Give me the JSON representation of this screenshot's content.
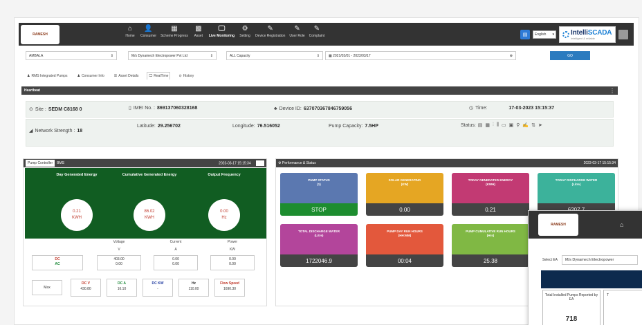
{
  "logo": {
    "text": "RAMESH"
  },
  "nav": [
    {
      "label": "Home",
      "icon": "home-icon",
      "glyph": "⌂"
    },
    {
      "label": "Consumer",
      "icon": "user-icon",
      "glyph": "👤"
    },
    {
      "label": "Scheme Progress",
      "icon": "table-icon",
      "glyph": "▦"
    },
    {
      "label": "Asset",
      "icon": "grid-icon",
      "glyph": "▩"
    },
    {
      "label": "Live Monitoring",
      "icon": "monitor-icon",
      "glyph": "🖵"
    },
    {
      "label": "Setting",
      "icon": "gear-icon",
      "glyph": "⚙"
    },
    {
      "label": "Device Registration",
      "icon": "edit-icon",
      "glyph": "✎"
    },
    {
      "label": "User Role",
      "icon": "edit-icon",
      "glyph": "✎"
    },
    {
      "label": "Complaint",
      "icon": "edit-icon",
      "glyph": "✎"
    }
  ],
  "language": "English",
  "brand": {
    "name_a": "Intelli",
    "name_b": "SCADA",
    "tagline": "Intelligent & reliable"
  },
  "filters": {
    "district": "AMBALA",
    "company": "M/s Dynamech Electropower Pvt Ltd",
    "capacity": "ALL Capacity",
    "daterange": "2021/03/01 - 2023/03/17",
    "go": "GO"
  },
  "subtabs": [
    {
      "label": "RMS Integrated Pumps",
      "glyph": "♟"
    },
    {
      "label": "Consumer Info",
      "glyph": "♟"
    },
    {
      "label": "Asset Details",
      "glyph": "☰"
    },
    {
      "label": "RealTime",
      "glyph": "🖵"
    },
    {
      "label": "History",
      "glyph": "⊙"
    }
  ],
  "heartbeat": {
    "title": "Heartbeat",
    "site_label": "Site :",
    "site": "SEDM C8168 0",
    "imei_label": "IMEI No. :",
    "imei": "869137060328168",
    "device_label": "Device ID:",
    "device": "637070367846759056",
    "time_label": "Time:",
    "time": "17-03-2023 15:15:37",
    "network_label": "Network Strength :",
    "network": "18",
    "lat_label": "Latitude:",
    "lat": "29.256702",
    "lon_label": "Longitude:",
    "lon": "76.516052",
    "cap_label": "Pump Capacity:",
    "cap": "7.5HP",
    "status_label": "Status:",
    "status_icons": [
      "▤",
      "▦",
      "⫶",
      "⫼",
      "▭",
      "▣",
      "⚲",
      "✍",
      "⇅",
      "➤"
    ]
  },
  "pump_controller": {
    "tab1": "Pump Controller",
    "tab2": "BMS",
    "timestamp": "2023-03-17 15:15:34",
    "cols": [
      {
        "label": "Day Generated Energy",
        "value": "0.21",
        "unit": "KWH"
      },
      {
        "label": "Cumulative Generated Energy",
        "value": "86.02",
        "unit": "KWH"
      },
      {
        "label": "Output Frequency",
        "value": "0.00",
        "unit": "Hz"
      }
    ],
    "voltage": "Voltage",
    "voltage_unit": "V",
    "current": "Current",
    "current_unit": "A",
    "power": "Power",
    "power_unit": "KW",
    "dc": "DC",
    "ac": "AC",
    "dc_vals": [
      "403.00",
      "0.00",
      "0.00"
    ],
    "ac_vals": [
      "0.00",
      "0.00",
      "0.00"
    ],
    "max": "Max",
    "stats": [
      {
        "label": "DC V",
        "value": "430.80",
        "color": "#c0392b"
      },
      {
        "label": "DC A",
        "value": "16.10",
        "color": "#1e8a3a"
      },
      {
        "label": "DC KW",
        "value": "-",
        "color": "#1f3aa0"
      },
      {
        "label": "Hz",
        "value": "110.00",
        "color": "#333333"
      },
      {
        "label": "Flow Speed",
        "value": "1690.30",
        "color": "#c0392b"
      }
    ]
  },
  "performance": {
    "title": "Performance & Status",
    "timestamp": "2023-03-17 15:15:34",
    "tiles": [
      {
        "label": "PUMP STATUS",
        "sub": "(1)",
        "value": "STOP",
        "color": "#5b78b0",
        "bot": "#1d8d2f"
      },
      {
        "label": "SOLAR GENERATING",
        "sub": "(KW)",
        "value": "0.00",
        "color": "#e5a623",
        "bot": "#444444"
      },
      {
        "label": "TODAY GENERATED ENERGY",
        "sub": "(KWH)",
        "value": "0.21",
        "color": "#c23a73",
        "bot": "#444444"
      },
      {
        "label": "TODAY DISCHARGE WATER",
        "sub": "(Litre)",
        "value": "6207.7",
        "color": "#3cb29b",
        "bot": "#444444"
      },
      {
        "label": "TOTAL DISCHARGE WATER",
        "sub": "(Litre)",
        "value": "1722046.9",
        "color": "#b3459b",
        "bot": "#444444"
      },
      {
        "label": "PUMP DAY RUN HOURS",
        "sub": "(HH:MM)",
        "value": "00:04",
        "color": "#e3583c",
        "bot": "#444444"
      },
      {
        "label": "PUMP CUMULATIVE RUN HOURS",
        "sub": "(Hrs)",
        "value": "25.38",
        "color": "#80b844",
        "bot": "#444444"
      }
    ]
  },
  "overlay": {
    "select_label": "Select EA",
    "select_value": "M/s Dynamech Electropower",
    "card_title": "Total Installed Pumps Reported by EA",
    "card_value": "718",
    "card2_title": "T"
  }
}
